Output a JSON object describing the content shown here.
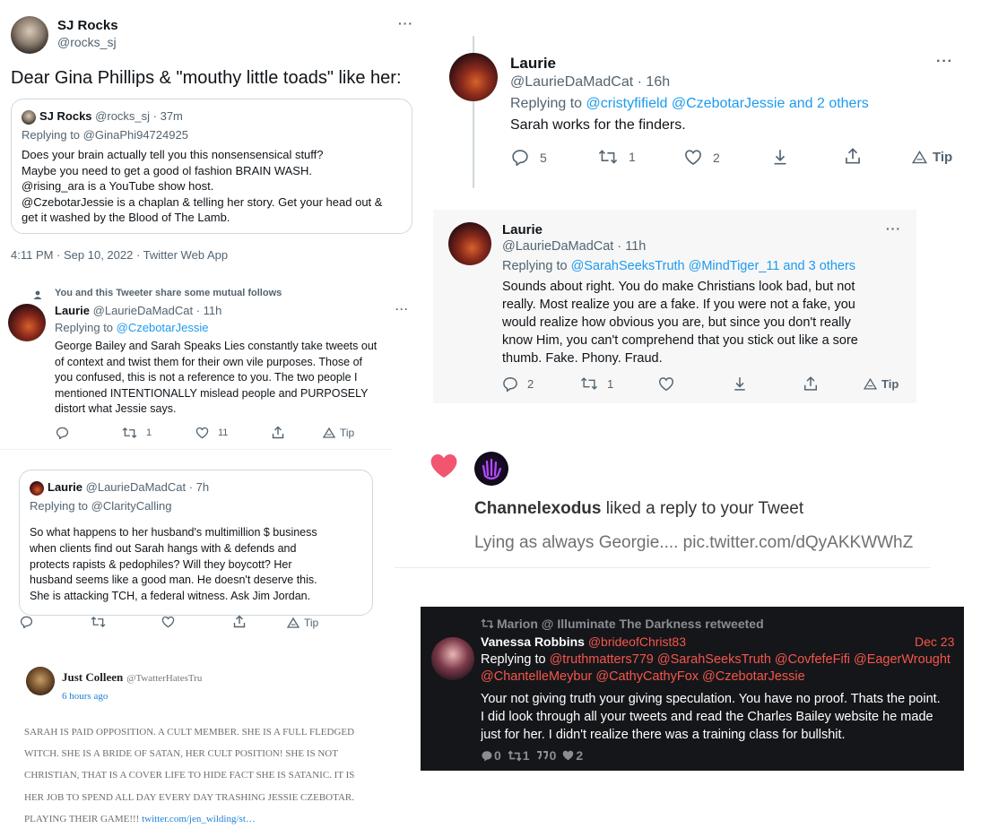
{
  "tweet1": {
    "name": "SJ Rocks",
    "handle": "@rocks_sj",
    "menu": "···",
    "text": "Dear Gina Phillips & \"mouthy little toads\" like her:",
    "quote": {
      "name": "SJ Rocks",
      "meta": "@rocks_sj · 37m",
      "replying_prefix": "Replying to ",
      "replying_to": "@GinaPhi94724925",
      "lines": [
        "Does your brain actually tell you this nonsensensical stuff?",
        "Maybe you need to get a good ol fashion BRAIN WASH.",
        "@rising_ara is a YouTube show host.",
        "@CzebotarJessie is a chaplan & telling her story. Get your head out &",
        "get it washed by the Blood of The Lamb."
      ]
    },
    "timestamp": "4:11 PM · Sep 10, 2022 · Twitter Web App"
  },
  "tweet2": {
    "mutual": "You and this Tweeter share some mutual follows",
    "name": "Laurie",
    "meta": "@LaurieDaMadCat · 11h",
    "menu": "···",
    "replying_prefix": "Replying to ",
    "replying_to": "@CzebotarJessie",
    "lines": [
      "George Bailey and Sarah Speaks Lies constantly take tweets out",
      "of context and twist them for their own vile purposes. Those of",
      "you confused, this is not a reference to you. The two people I",
      "mentioned INTENTIONALLY mislead people and PURPOSELY",
      "distort what Jessie says."
    ],
    "retweets": "1",
    "likes": "11",
    "tip": "Tip"
  },
  "tweet3": {
    "name": "Laurie",
    "meta": "@LaurieDaMadCat · 7h",
    "replying_prefix": "Replying to ",
    "replying_to": "@ClarityCalling",
    "lines": [
      "So what happens to her husband's multimillion $ business",
      "when clients find out Sarah hangs with & defends and",
      "protects rapists & pedophiles?  Will they boycott? Her",
      "husband seems like a good man. He doesn't deserve this.",
      "She is attacking TCH, a federal witness. Ask Jim Jordan."
    ],
    "tip": "Tip"
  },
  "tweet4": {
    "name": "Just Colleen",
    "handle": "@TwatterHatesTru",
    "time": "6 hours ago",
    "lines": [
      "SARAH IS PAID OPPOSITION. A CULT MEMBER. SHE IS A FULL FLEDGED",
      "WITCH. SHE IS A BRIDE OF SATAN, HER CULT POSITION! SHE IS NOT",
      "CHRISTIAN, THAT IS A COVER LIFE TO HIDE FACT SHE IS SATANIC. IT IS",
      "HER JOB TO SPEND ALL DAY EVERY DAY TRASHING JESSIE CZEBOTAR."
    ],
    "last_line": "PLAYING THEIR GAME!!! ",
    "link": "twitter.com/jen_wilding/st…"
  },
  "tweet5": {
    "name": "Laurie",
    "meta": "@LaurieDaMadCat · 16h",
    "menu": "···",
    "replying_prefix": "Replying to ",
    "replying_to": "@cristyfifield @CzebotarJessie and 2 others",
    "text": "Sarah works for the finders.",
    "replies": "5",
    "retweets": "1",
    "likes": "2",
    "tip": "Tip"
  },
  "tweet6": {
    "name": "Laurie",
    "meta": "@LaurieDaMadCat · 11h",
    "menu": "···",
    "replying_prefix": "Replying to ",
    "replying_to": "@SarahSeeksTruth @MindTiger_11 and 3 others",
    "lines": [
      "Sounds about right. You do make Christians look bad, but not",
      "really. Most realize you are a fake.  If you were not a fake, you",
      "would realize how obvious you are, but since you don't really",
      "know Him, you can't comprehend that you stick out like a sore",
      "thumb. Fake. Phony. Fraud."
    ],
    "replies": "2",
    "retweets": "1",
    "tip": "Tip"
  },
  "notification": {
    "name": "Channelexodus",
    "action": " liked a reply to your Tweet",
    "text": "Lying as always Georgie.... pic.twitter.com/dQyAKKWWhZ"
  },
  "dark_tweet": {
    "retweeted_by": "Marion @ Illuminate The Darkness retweeted",
    "name": "Vanessa Robbins",
    "handle": "@brideofChrist83",
    "date": "Dec 23",
    "replying_prefix": "Replying to ",
    "replying_line1": "@truthmatters779 @SarahSeeksTruth @CovfefeFifi @EagerWrought",
    "replying_line2": "@ChantelleMeybur @CathyCathyFox @CzebotarJessie",
    "lines": [
      "Your not giving truth your giving speculation. You have no proof. Thats the point.",
      "I did look through all your tweets and read the Charles Bailey website he made",
      "just for her. I didn't realize there was a training class for bullshit."
    ],
    "stats": {
      "replies": "0",
      "retweets": "1",
      "quotes": "0",
      "likes": "2"
    }
  },
  "colors": {
    "accent": "#1d9bf0",
    "like_heart": "#f2556f",
    "dark_bg": "#15161a",
    "dark_accent": "#f4564b"
  }
}
